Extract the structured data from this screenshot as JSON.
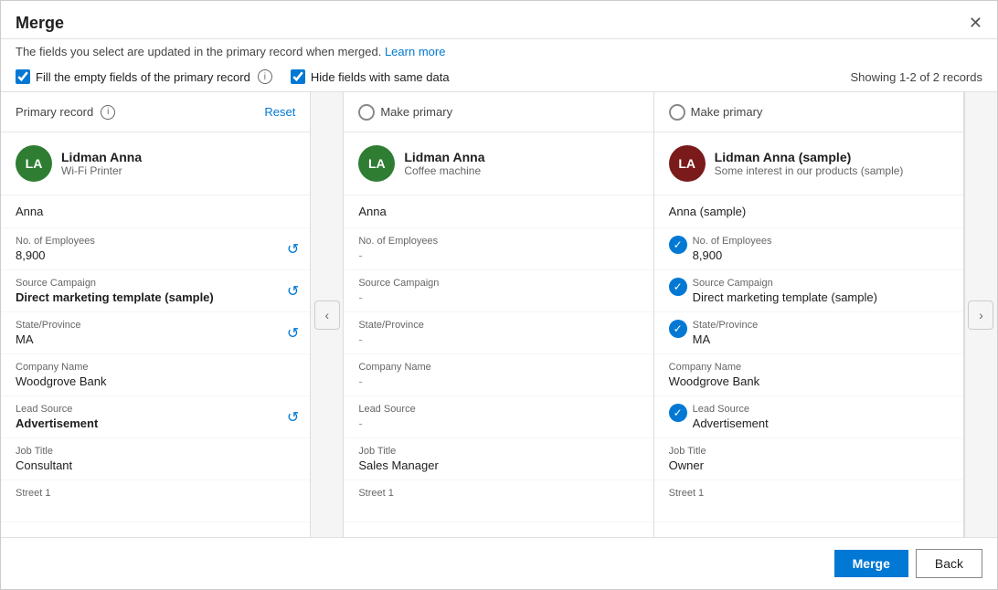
{
  "dialog": {
    "title": "Merge",
    "subtitle": "The fields you select are updated in the primary record when merged.",
    "learn_more": "Learn more",
    "close_icon": "✕"
  },
  "toolbar": {
    "fill_empty_label": "Fill the empty fields of the primary record",
    "hide_same_label": "Hide fields with same data",
    "showing_label": "Showing 1-2 of 2 records"
  },
  "columns": [
    {
      "id": "primary",
      "header_label": "Primary record",
      "header_action": "Reset",
      "is_primary": true,
      "avatar_initials": "LA",
      "avatar_class": "avatar-green",
      "record_name": "Lidman Anna",
      "record_sub": "Wi-Fi Printer",
      "first_name": "Anna",
      "fields": [
        {
          "label": "No. of Employees",
          "value": "8,900",
          "bold": false,
          "dash": false,
          "checkable": false,
          "restore": true
        },
        {
          "label": "Source Campaign",
          "value": "Direct marketing template (sample)",
          "bold": true,
          "dash": false,
          "checkable": false,
          "restore": true
        },
        {
          "label": "State/Province",
          "value": "MA",
          "bold": false,
          "dash": false,
          "checkable": false,
          "restore": true
        },
        {
          "label": "Company Name",
          "value": "Woodgrove Bank",
          "bold": false,
          "dash": false,
          "checkable": false,
          "restore": false
        },
        {
          "label": "Lead Source",
          "value": "Advertisement",
          "bold": true,
          "dash": false,
          "checkable": false,
          "restore": true
        },
        {
          "label": "Job Title",
          "value": "Consultant",
          "bold": false,
          "dash": false,
          "checkable": false,
          "restore": false
        },
        {
          "label": "Street 1",
          "value": "",
          "bold": false,
          "dash": false,
          "checkable": false,
          "restore": false
        }
      ]
    },
    {
      "id": "col2",
      "header_label": "Make primary",
      "is_primary": false,
      "avatar_initials": "LA",
      "avatar_class": "avatar-green",
      "record_name": "Lidman Anna",
      "record_sub": "Coffee machine",
      "first_name": "Anna",
      "fields": [
        {
          "label": "No. of Employees",
          "value": "-",
          "bold": false,
          "dash": true,
          "checkable": false,
          "restore": false
        },
        {
          "label": "Source Campaign",
          "value": "-",
          "bold": false,
          "dash": true,
          "checkable": false,
          "restore": false
        },
        {
          "label": "State/Province",
          "value": "-",
          "bold": false,
          "dash": true,
          "checkable": false,
          "restore": false
        },
        {
          "label": "Company Name",
          "value": "-",
          "bold": false,
          "dash": true,
          "checkable": false,
          "restore": false
        },
        {
          "label": "Lead Source",
          "value": "-",
          "bold": false,
          "dash": true,
          "checkable": false,
          "restore": false
        },
        {
          "label": "Job Title",
          "value": "Sales Manager",
          "bold": false,
          "dash": false,
          "checkable": false,
          "restore": false
        },
        {
          "label": "Street 1",
          "value": "",
          "bold": false,
          "dash": false,
          "checkable": false,
          "restore": false
        }
      ]
    },
    {
      "id": "col3",
      "header_label": "Make primary",
      "is_primary": false,
      "avatar_initials": "LA",
      "avatar_class": "avatar-dark-red",
      "record_name": "Lidman Anna (sample)",
      "record_sub": "Some interest in our products (sample)",
      "first_name": "Anna (sample)",
      "fields": [
        {
          "label": "No. of Employees",
          "value": "8,900",
          "bold": false,
          "dash": false,
          "checkable": true,
          "restore": false
        },
        {
          "label": "Source Campaign",
          "value": "Direct marketing template (sample)",
          "bold": false,
          "dash": false,
          "checkable": true,
          "restore": false
        },
        {
          "label": "State/Province",
          "value": "MA",
          "bold": false,
          "dash": false,
          "checkable": true,
          "restore": false
        },
        {
          "label": "Company Name",
          "value": "Woodgrove Bank",
          "bold": false,
          "dash": false,
          "checkable": false,
          "restore": false
        },
        {
          "label": "Lead Source",
          "value": "Advertisement",
          "bold": false,
          "dash": false,
          "checkable": true,
          "restore": false
        },
        {
          "label": "Job Title",
          "value": "Owner",
          "bold": false,
          "dash": false,
          "checkable": false,
          "restore": false
        },
        {
          "label": "Street 1",
          "value": "",
          "bold": false,
          "dash": false,
          "checkable": false,
          "restore": false
        }
      ]
    }
  ],
  "footer": {
    "merge_label": "Merge",
    "back_label": "Back"
  }
}
